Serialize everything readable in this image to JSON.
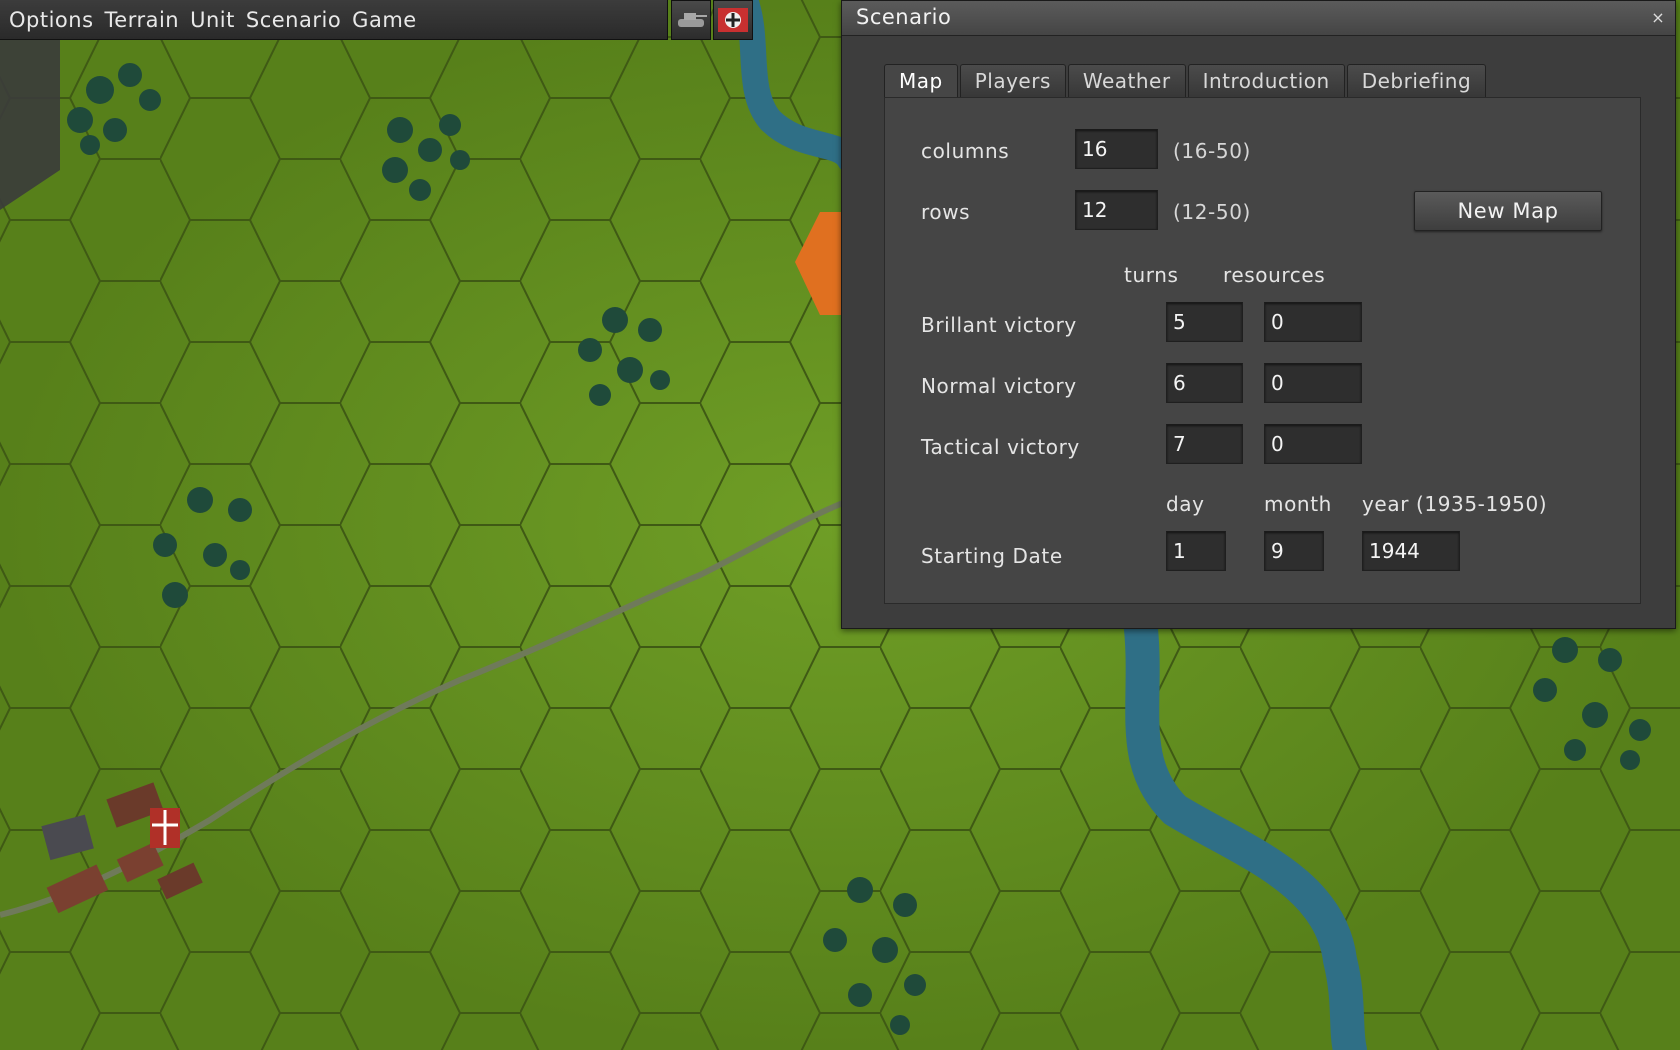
{
  "menu": {
    "items": [
      "Options",
      "Terrain",
      "Unit",
      "Scenario",
      "Game"
    ]
  },
  "toolbar": {
    "unit_icon": "tank-icon",
    "flag_icon": "faction-flag-icon"
  },
  "dialog": {
    "title": "Scenario",
    "close_label": "×",
    "tabs": [
      "Map",
      "Players",
      "Weather",
      "Introduction",
      "Debriefing"
    ],
    "active_tab": "Map",
    "map": {
      "columns_label": "columns",
      "columns_value": "16",
      "columns_range": "(16-50)",
      "rows_label": "rows",
      "rows_value": "12",
      "rows_range": "(12-50)",
      "new_map_label": "New Map",
      "turns_header": "turns",
      "resources_header": "resources",
      "victories": [
        {
          "label": "Brillant victory",
          "turns": "5",
          "resources": "0"
        },
        {
          "label": "Normal victory",
          "turns": "6",
          "resources": "0"
        },
        {
          "label": "Tactical victory",
          "turns": "7",
          "resources": "0"
        }
      ],
      "day_header": "day",
      "month_header": "month",
      "year_header": "year (1935-1950)",
      "starting_date_label": "Starting Date",
      "day_value": "1",
      "month_value": "9",
      "year_value": "1944"
    }
  },
  "colors": {
    "grass": "#5e8a1c",
    "hex_line": "#3f5a14",
    "river": "#2f6f86",
    "road": "#6f7a5a",
    "highlight_hex": "#e07020",
    "forest": "#1f4a3a",
    "dialog_bg": "#3d3d3d"
  }
}
